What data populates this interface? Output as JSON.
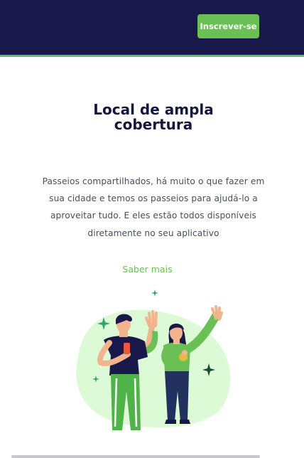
{
  "header": {
    "signup_label": "Inscrever-se",
    "background_color": "#18184a",
    "accent_color": "#6ac054"
  },
  "section": {
    "title_lines": [
      "Local de ampla",
      "cobertura"
    ],
    "description_lines": [
      "Passeios compartilhados, há muito o que fazer em",
      "sua cidade e temos os passeios para ajudá-lo a",
      "aproveitar tudo. E eles estão todos disponíveis",
      "diretamente no seu aplicativo"
    ],
    "learn_more_label": "Saber mais"
  },
  "illustration": {
    "icon": "friends-waving-illustration"
  }
}
